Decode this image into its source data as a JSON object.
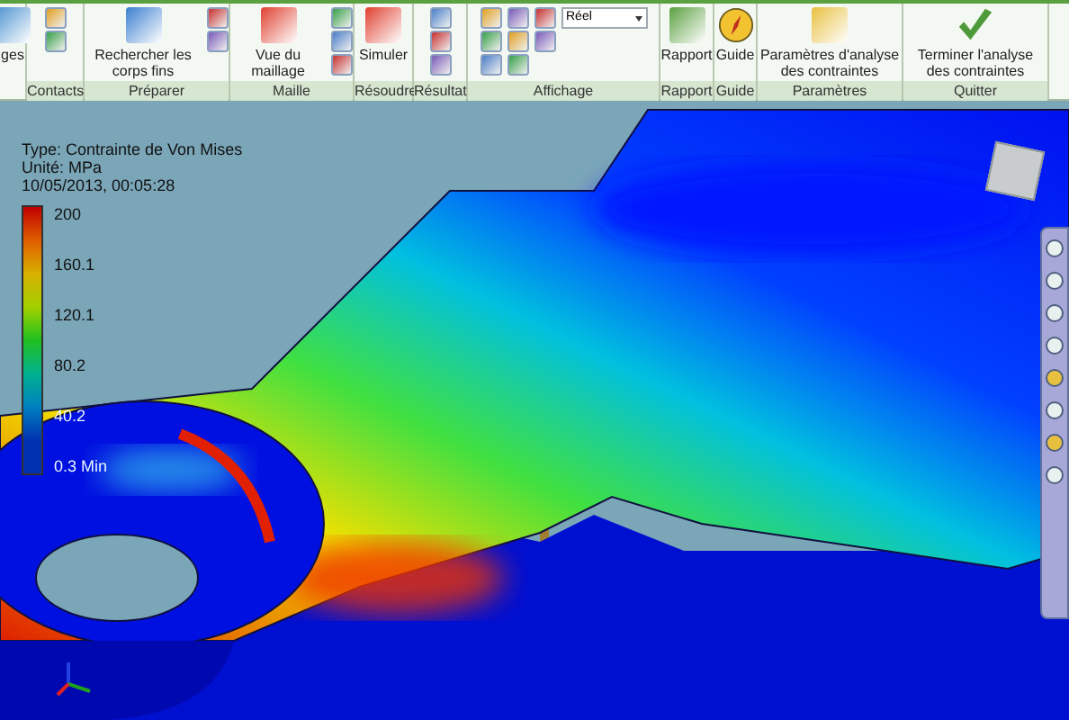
{
  "ribbon": {
    "groups": [
      {
        "items": [
          {
            "kind": "large",
            "label": "ges"
          }
        ]
      },
      {
        "label": "Contacts",
        "items": [
          {
            "kind": "small"
          },
          {
            "kind": "small"
          }
        ]
      },
      {
        "label": "Préparer",
        "items": [
          {
            "kind": "large",
            "label": "Rechercher les corps fins"
          },
          {
            "kind": "small"
          },
          {
            "kind": "small"
          }
        ]
      },
      {
        "label": "Maille",
        "items": [
          {
            "kind": "large",
            "label": "Vue du maillage"
          },
          {
            "kind": "small"
          },
          {
            "kind": "small"
          },
          {
            "kind": "small"
          }
        ]
      },
      {
        "label": "Résoudre",
        "items": [
          {
            "kind": "large",
            "label": "Simuler"
          }
        ]
      },
      {
        "label": "Résultat",
        "items": [
          {
            "kind": "small"
          },
          {
            "kind": "small"
          },
          {
            "kind": "small"
          }
        ]
      },
      {
        "label": "Affichage",
        "items": [
          {
            "kind": "small"
          },
          {
            "kind": "small"
          },
          {
            "kind": "small"
          },
          {
            "kind": "small"
          },
          {
            "kind": "small"
          },
          {
            "kind": "small"
          },
          {
            "kind": "small"
          },
          {
            "kind": "small"
          },
          {
            "kind": "dropdown",
            "value": "Réel"
          }
        ]
      },
      {
        "label": "Rapport",
        "items": [
          {
            "kind": "large",
            "label": "Rapport"
          }
        ]
      },
      {
        "label": "Guide",
        "items": [
          {
            "kind": "large",
            "label": "Guide"
          }
        ]
      },
      {
        "label": "Paramètres",
        "items": [
          {
            "kind": "large",
            "label": "Paramètres d'analyse des contraintes"
          }
        ]
      },
      {
        "label": "Quitter",
        "items": [
          {
            "kind": "large",
            "label": "Terminer l'analyse des contraintes"
          }
        ]
      }
    ]
  },
  "legend": {
    "type": "Type: Contrainte de Von Mises",
    "unit": "Unité: MPa",
    "date": "10/05/2013, 00:05:28",
    "scale": [
      "200",
      "160.1",
      "120.1",
      "80.2",
      "40.2",
      "0.3 Min"
    ]
  }
}
